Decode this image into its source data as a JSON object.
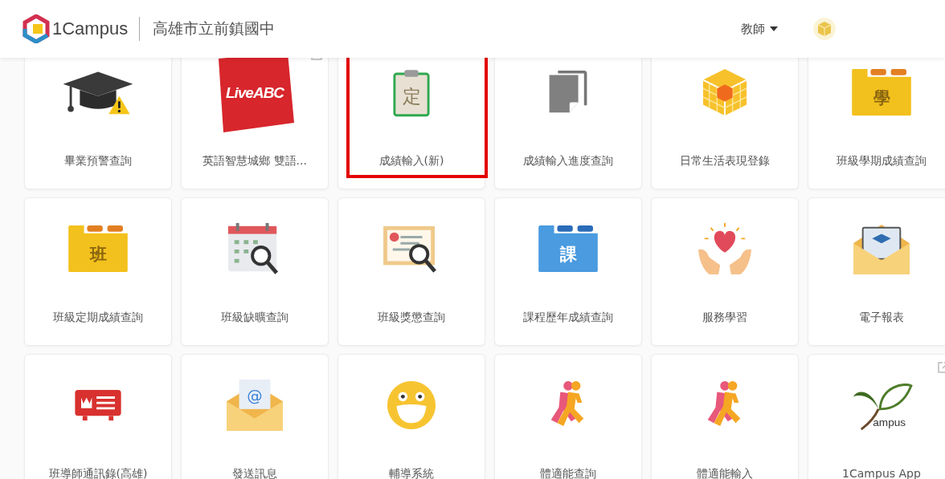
{
  "header": {
    "brand": "1Campus",
    "school": "高雄市立前鎮國中",
    "role": "教師"
  },
  "apps": [
    {
      "label": "畢業預警查詢",
      "kind": "cap-warning",
      "highlighted": false,
      "external": false
    },
    {
      "label": "英語智慧城鄉 雙語...",
      "kind": "logo-square",
      "icon_label": "LiveABC",
      "highlighted": false,
      "external": true
    },
    {
      "label": "成績輸入(新)",
      "kind": "clipboard",
      "icon_label": "定",
      "highlighted": true,
      "external": false
    },
    {
      "label": "成績輸入進度查詢",
      "kind": "documents",
      "highlighted": false,
      "external": false
    },
    {
      "label": "日常生活表現登錄",
      "kind": "cube",
      "highlighted": false,
      "external": false
    },
    {
      "label": "班級學期成績查詢",
      "kind": "folder",
      "icon_label": "學",
      "highlighted": false,
      "external": false
    },
    {
      "label": "班級定期成績查詢",
      "kind": "folder",
      "icon_label": "班",
      "highlighted": false,
      "external": false
    },
    {
      "label": "班級缺曠查詢",
      "kind": "calendar-search",
      "highlighted": false,
      "external": false
    },
    {
      "label": "班級獎懲查詢",
      "kind": "certificate-search",
      "highlighted": false,
      "external": false
    },
    {
      "label": "課程歷年成績查詢",
      "kind": "folder-blue",
      "icon_label": "課",
      "highlighted": false,
      "external": false
    },
    {
      "label": "服務學習",
      "kind": "heart-hands",
      "highlighted": false,
      "external": false
    },
    {
      "label": "電子報表",
      "kind": "envelope-doc",
      "highlighted": false,
      "external": false
    },
    {
      "label": "班導師通訊錄(高雄)",
      "kind": "id-card",
      "highlighted": false,
      "external": false
    },
    {
      "label": "發送訊息",
      "kind": "envelope",
      "icon_label": "@",
      "highlighted": false,
      "external": false
    },
    {
      "label": "輔導系統",
      "kind": "smiley",
      "highlighted": false,
      "external": false
    },
    {
      "label": "體適能查詢",
      "kind": "runner",
      "highlighted": false,
      "external": false
    },
    {
      "label": "體適能輸入",
      "kind": "runner",
      "highlighted": false,
      "external": false
    },
    {
      "label": "1Campus App",
      "kind": "leaf-logo",
      "icon_label": "ampus",
      "highlighted": false,
      "external": true
    }
  ]
}
